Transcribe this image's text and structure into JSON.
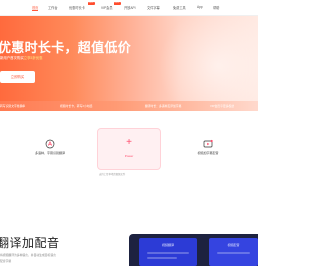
{
  "nav": {
    "items": [
      {
        "label": "首页",
        "active": true
      },
      {
        "label": "工作台",
        "active": false
      },
      {
        "label": "优惠时长卡",
        "active": false,
        "badge": "HOT"
      },
      {
        "label": "VIP会员",
        "active": false,
        "badge": "HOT"
      },
      {
        "label": "开放API",
        "active": false
      },
      {
        "label": "文件字幕",
        "active": false
      },
      {
        "label": "免费工具",
        "active": false
      },
      {
        "label": "App",
        "active": false
      },
      {
        "label": "帮助",
        "active": false
      }
    ]
  },
  "banner": {
    "title": "优惠时长卡，超值低价",
    "subtitle_prefix": "新用户首次购买",
    "subtitle_highlight": "立享5折优惠",
    "button_label": "立即购买"
  },
  "strip": {
    "items": [
      "转写识别文字准确率",
      "视频时长卡，转写2小时起",
      "翻译时长：多语种互译加字幕",
      "VIP会员享更多权益"
    ]
  },
  "features": {
    "left_label": "多语种、字幕识别翻译",
    "upload_label": "Power",
    "upload_hint": "支持上传本地音视频文件",
    "right_label": "视频加字幕配音"
  },
  "section": {
    "title": "翻译加配音",
    "sub1": "将视频翻译为多种语言，并自动生成目标语言",
    "sub2": "配音字幕"
  },
  "preview": {
    "panel1_title": "视频翻译",
    "panel2_title": "视频配音"
  },
  "colors": {
    "accent": "#ff5a3c",
    "upload_accent": "#ff4d6d",
    "preview_bg": "#1d2240",
    "panel_blue": "#2c3bd6"
  }
}
